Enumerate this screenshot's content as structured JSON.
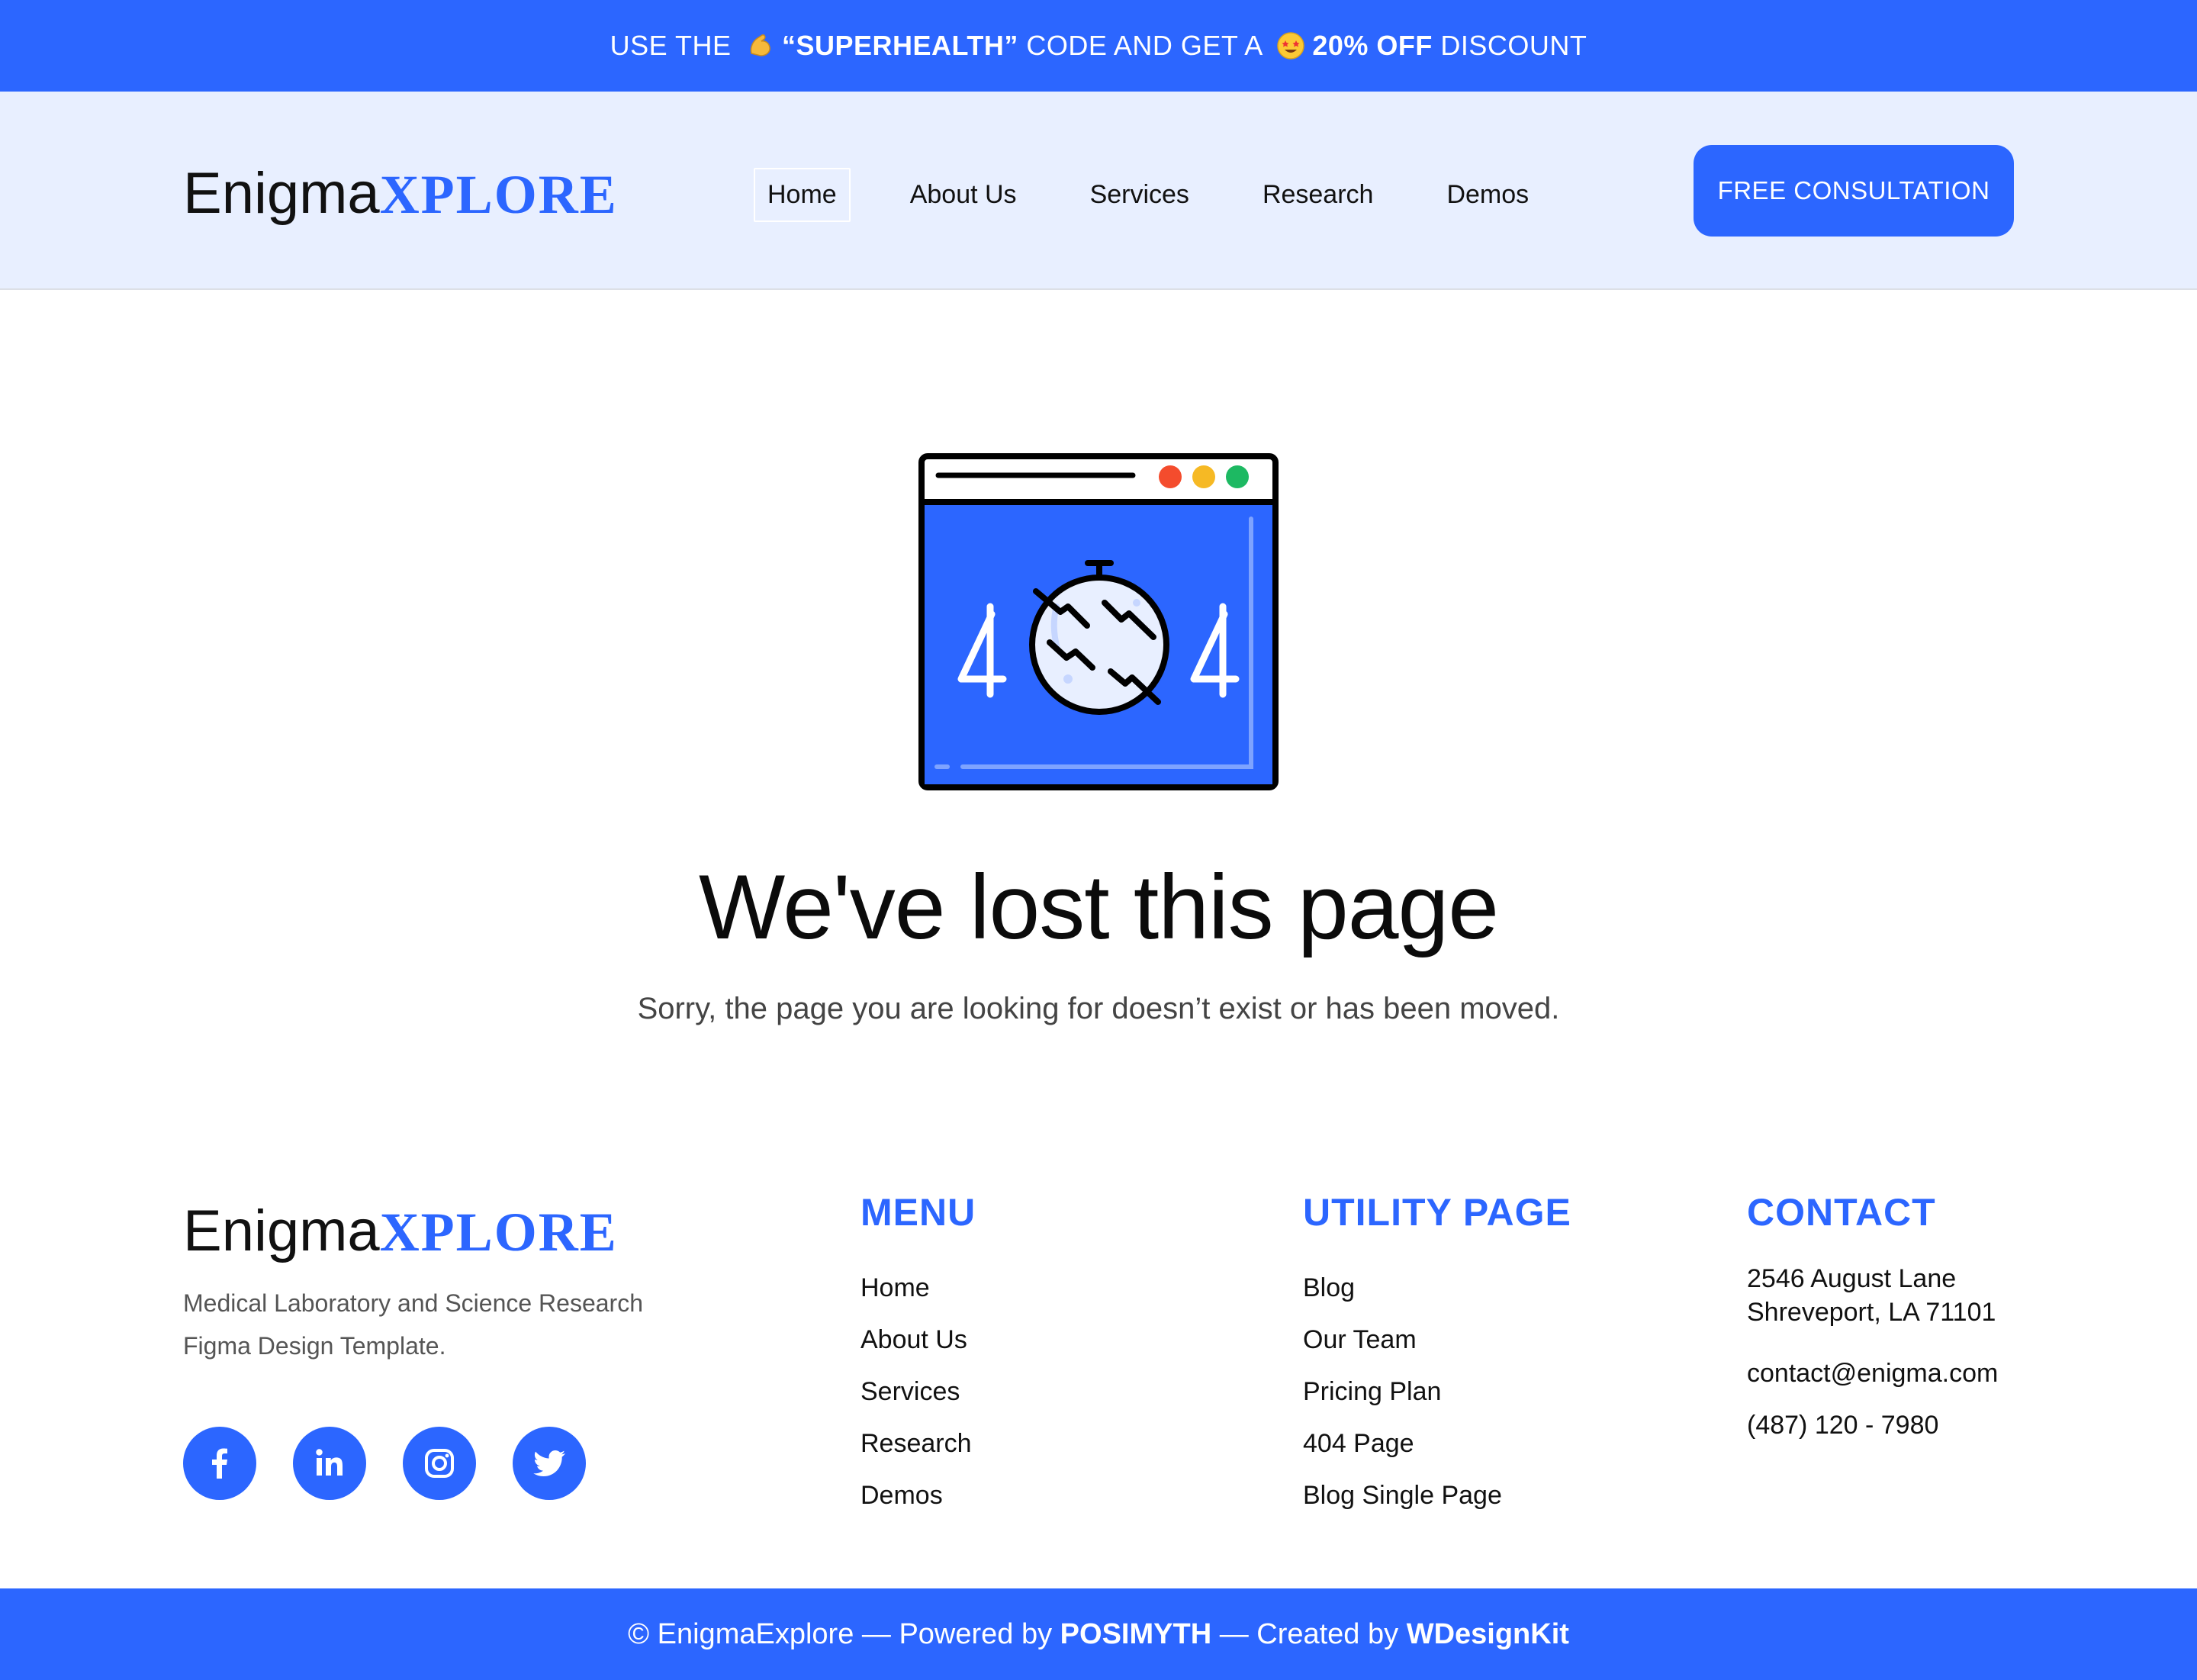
{
  "promo": {
    "part1": "USE THE ",
    "code": "“SUPERHEALTH”",
    "part2": " CODE AND GET A ",
    "discount": "20% OFF",
    "part3": " DISCOUNT"
  },
  "brand": {
    "logo_part1": "Enigma",
    "logo_part2": "XPLORE"
  },
  "nav": {
    "items": [
      "Home",
      "About Us",
      "Services",
      "Research",
      "Demos"
    ],
    "cta": "FREE CONSULTATION"
  },
  "main": {
    "title": "We've lost this page",
    "subtitle": "Sorry, the page you are looking for doesn’t exist or has been moved."
  },
  "footer": {
    "description": "Medical Laboratory and Science Research Figma Design Template.",
    "menu": {
      "heading": "MENU",
      "links": [
        "Home",
        "About Us",
        "Services",
        "Research",
        "Demos"
      ]
    },
    "utility": {
      "heading": "UTILITY PAGE",
      "links": [
        "Blog",
        "Our Team",
        "Pricing Plan",
        "404 Page",
        "Blog Single Page"
      ]
    },
    "contact": {
      "heading": "CONTACT",
      "address_line1": "2546 August Lane",
      "address_line2": "Shreveport, LA 71101",
      "email": "contact@enigma.com",
      "phone": "(487) 120 - 7980"
    },
    "socials": [
      "facebook-icon",
      "linkedin-icon",
      "instagram-icon",
      "twitter-icon"
    ]
  },
  "bottom": {
    "part1": "© EnigmaExplore — Powered by ",
    "brand1": "POSIMYTH",
    "part2": " — Created by ",
    "brand2": "WDesignKit"
  },
  "colors": {
    "accent": "#2c66ff",
    "header_bg": "#e8efff"
  }
}
